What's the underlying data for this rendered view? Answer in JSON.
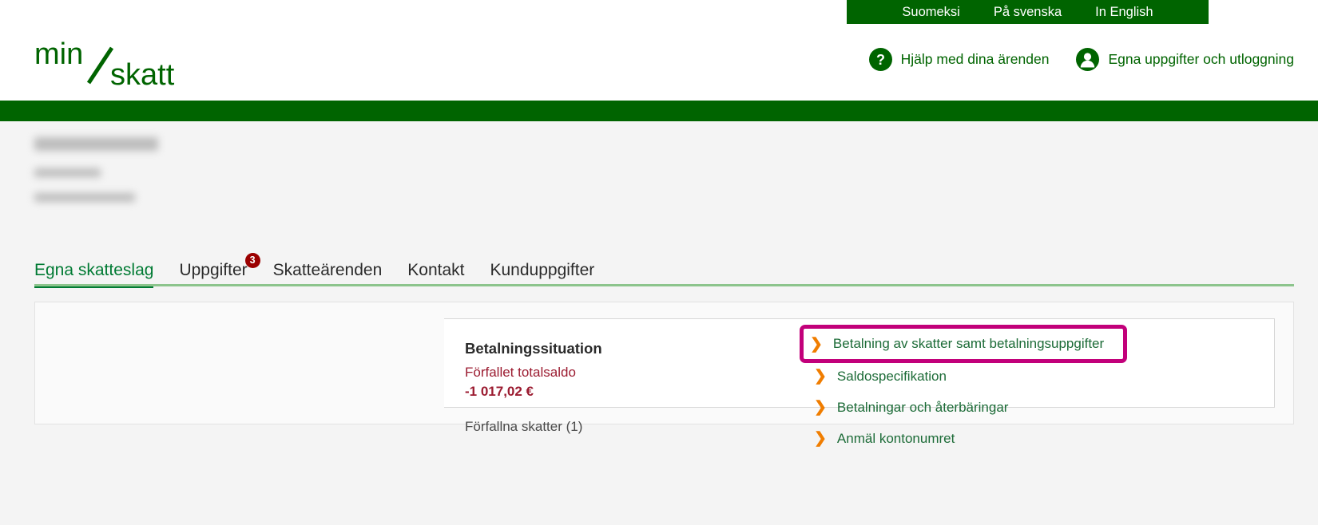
{
  "topbar": {
    "languages": [
      {
        "label": "Suomeksi",
        "name": "lang-fi"
      },
      {
        "label": "På svenska",
        "name": "lang-sv"
      },
      {
        "label": "In English",
        "name": "lang-en"
      }
    ],
    "external_link": "vero.fi",
    "bar_color": "#006400"
  },
  "header": {
    "logo_top": "min",
    "logo_bottom": "skatt",
    "logo_color": "#006400",
    "tools": [
      {
        "label": "Hjälp med dina ärenden",
        "icon": "help-question-icon"
      },
      {
        "label": "Egna uppgifter och utloggning",
        "icon": "user-account-icon"
      }
    ]
  },
  "tabs": [
    {
      "label": "Egna skatteslag",
      "active": true,
      "badge": null
    },
    {
      "label": "Uppgifter",
      "active": false,
      "badge": "3"
    },
    {
      "label": "Skatteärenden",
      "active": false,
      "badge": null
    },
    {
      "label": "Kontakt",
      "active": false,
      "badge": null
    },
    {
      "label": "Kunduppgifter",
      "active": false,
      "badge": null
    }
  ],
  "card": {
    "title": "Betalningssituation",
    "overdue_label": "Förfallet totalsaldo",
    "overdue_amount": "-1 017,02 €",
    "subline": "Förfallna skatter (1)",
    "accent_color": "#00a000",
    "amount_color": "#9b1b30",
    "links": [
      {
        "label": "Betalning av skatter samt betalningsuppgifter",
        "highlighted": true
      },
      {
        "label": "Saldospecifikation",
        "highlighted": false
      },
      {
        "label": "Betalningar och återbäringar",
        "highlighted": false
      },
      {
        "label": "Anmäl kontonumret",
        "highlighted": false
      }
    ],
    "highlight_color": "#c2007a",
    "chevron_color": "#f07d00",
    "link_color": "#1c6b37"
  }
}
